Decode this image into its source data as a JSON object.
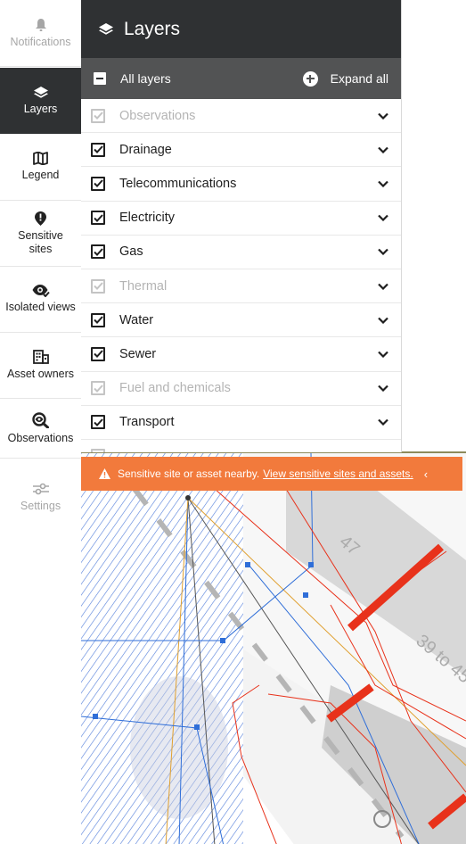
{
  "rail": {
    "items": [
      {
        "label": "Notifications",
        "icon": "bell-icon",
        "state": "disabled"
      },
      {
        "label": "Layers",
        "icon": "layers-icon",
        "state": "active"
      },
      {
        "label": "Legend",
        "icon": "map-icon",
        "state": "normal"
      },
      {
        "label": "Sensitive sites",
        "icon": "location-alert-icon",
        "state": "normal"
      },
      {
        "label": "Isolated views",
        "icon": "eye-check-icon",
        "state": "normal"
      },
      {
        "label": "Asset owners",
        "icon": "building-icon",
        "state": "normal"
      },
      {
        "label": "Observations",
        "icon": "magnifier-eye-icon",
        "state": "normal"
      },
      {
        "label": "Settings",
        "icon": "sliders-icon",
        "state": "disabled"
      }
    ]
  },
  "panel": {
    "title": "Layers",
    "all_layers_label": "All layers",
    "expand_all_label": "Expand all",
    "layers": [
      {
        "label": "Observations",
        "checked": true,
        "disabled": true
      },
      {
        "label": "Drainage",
        "checked": true,
        "disabled": false
      },
      {
        "label": "Telecommunications",
        "checked": true,
        "disabled": false
      },
      {
        "label": "Electricity",
        "checked": true,
        "disabled": false
      },
      {
        "label": "Gas",
        "checked": true,
        "disabled": false
      },
      {
        "label": "Thermal",
        "checked": true,
        "disabled": true
      },
      {
        "label": "Water",
        "checked": true,
        "disabled": false
      },
      {
        "label": "Sewer",
        "checked": true,
        "disabled": false
      },
      {
        "label": "Fuel and chemicals",
        "checked": true,
        "disabled": true
      },
      {
        "label": "Transport",
        "checked": true,
        "disabled": false
      }
    ]
  },
  "banner": {
    "text": "Sensitive site or asset nearby.",
    "link": "View sensitive sites and assets.",
    "collapse_glyph": "‹"
  },
  "map": {
    "labels": {
      "parcel_a": "47",
      "parcel_b": "39 to 45"
    }
  },
  "colors": {
    "dark": "#2f3133",
    "subheader": "#525354",
    "banner": "#f27a3c",
    "electric_red": "#e8321b",
    "water_blue": "#2f6ed8",
    "hatch_blue": "#3f6fd6"
  }
}
